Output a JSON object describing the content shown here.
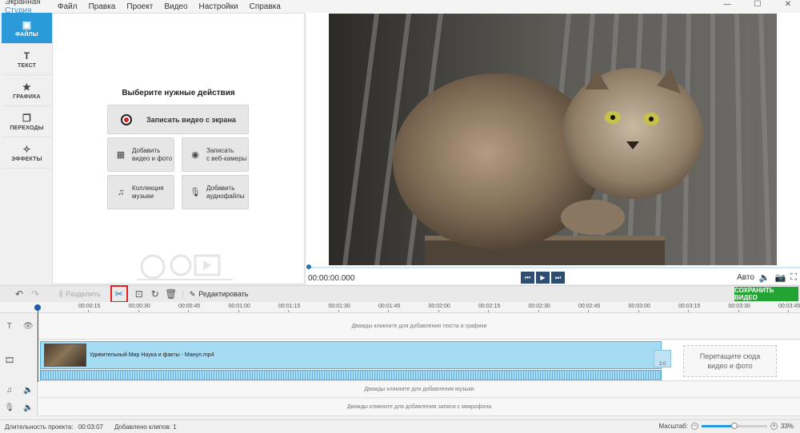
{
  "titlebar": {
    "app_name": "Экранная",
    "app_name_accent": "Студия",
    "menu": [
      "Файл",
      "Правка",
      "Проект",
      "Видео",
      "Настройки",
      "Справка"
    ]
  },
  "rail": {
    "tabs": [
      {
        "label": "ФАЙЛЫ",
        "icon": "folder-icon",
        "active": true
      },
      {
        "label": "ТЕКСТ",
        "icon": "text-icon"
      },
      {
        "label": "ГРАФИКА",
        "icon": "star-icon"
      },
      {
        "label": "ПЕРЕХОДЫ",
        "icon": "transitions-icon"
      },
      {
        "label": "ЭФФЕКТЫ",
        "icon": "wand-icon"
      }
    ]
  },
  "files_panel": {
    "title": "Выберите нужные действия",
    "record_label": "Записать видео с экрана",
    "add_video_label": "Добавить\nвидео и фото",
    "webcam_label": "Записать\nс веб-камеры",
    "music_label": "Коллекция\nмузыки",
    "audio_label": "Добавить\nаудиофайлы"
  },
  "player": {
    "timecode": "00:00:00.000",
    "auto_label": "Авто",
    "progress": 0
  },
  "toolbar": {
    "split_label": "Разделить",
    "edit_label": "Редактировать",
    "save_label": "СОХРАНИТЬ ВИДЕО"
  },
  "ruler": {
    "ticks": [
      "00:00:15",
      "00:00:30",
      "00:00:45",
      "00:01:00",
      "00:01:15",
      "00:01:30",
      "00:01:45",
      "00:02:00",
      "00:02:15",
      "00:02:30",
      "00:02:45",
      "00:03:00",
      "00:03:15",
      "00:03:30",
      "00:03:45"
    ]
  },
  "tracks": {
    "text_hint": "Дважды кликните для добавления текста и графики",
    "clip_name": "Удивительный Мир  Наука и факты - Манул.mp4",
    "transition_label": "2.0",
    "drop_hint": "Перетащите сюда\nвидео и фото",
    "music_hint": "Дважды кликните для добавления музыки",
    "mic_hint": "Дважды кликните для добавления записи с микрофона"
  },
  "statusbar": {
    "duration_label": "Длительность проекта:",
    "duration_value": "00:03:07",
    "clips_label": "Добавлено клипов: 1",
    "zoom_label": "Масштаб:",
    "zoom_value": "33%",
    "zoom_fraction": 0.5
  },
  "colors": {
    "accent": "#2a9ad8",
    "save_button": "#22a334",
    "clip": "#a5dcf3",
    "highlight": "#e02020"
  }
}
